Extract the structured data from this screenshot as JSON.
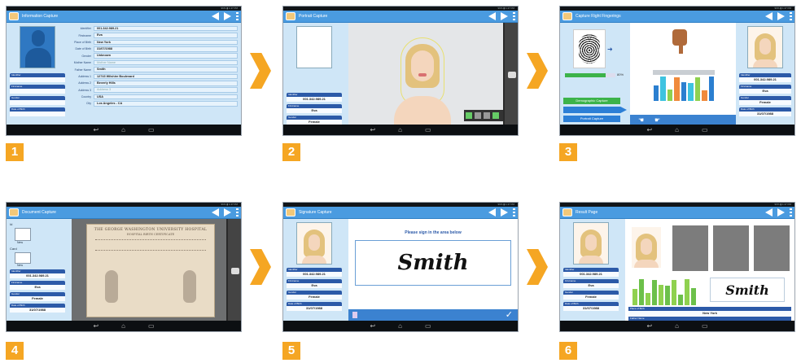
{
  "steps": [
    {
      "badge": "1",
      "title": "Information Capture"
    },
    {
      "badge": "2",
      "title": "Portrait Capture"
    },
    {
      "badge": "3",
      "title": "Capture Right Fingerings"
    },
    {
      "badge": "4",
      "title": "Document Capture"
    },
    {
      "badge": "5",
      "title": "Signature Capture"
    },
    {
      "badge": "6",
      "title": "Result Page"
    }
  ],
  "status_bar": "96% ▮ 1:47 PM",
  "form": {
    "rows": [
      {
        "label": "Identifier",
        "value": "001.342.989.21"
      },
      {
        "label": "Firstname",
        "value": "Eva"
      },
      {
        "label": "Place of Birth",
        "value": "New York"
      },
      {
        "label": "Date of Birth",
        "value": "31/07/1988"
      },
      {
        "label": "Gender",
        "value": "Unknown"
      },
      {
        "label": "Mother Name",
        "value": "Mother Name",
        "placeholder": true
      },
      {
        "label": "Father Name",
        "value": "Smith"
      },
      {
        "label": "Address 1",
        "value": "12743 Wilshire Boulevard"
      },
      {
        "label": "Address 2",
        "value": "Beverly Hills"
      },
      {
        "label": "Address 3",
        "value": "Address 3",
        "placeholder": true
      },
      {
        "label": "Country",
        "value": "USA"
      },
      {
        "label": "City",
        "value": "Los Angeles - CA"
      }
    ]
  },
  "person": {
    "labels": [
      "Identifier",
      "Firstname",
      "Gender",
      "Date of Birth"
    ],
    "values": [
      "001.342.989.21",
      "Eva",
      "Female",
      "31/07/1988"
    ]
  },
  "fingerprint": {
    "progress_text": "80%",
    "progress": 0.8,
    "button1": "Demographic Capture",
    "button2": "Portrait Capture"
  },
  "doc": {
    "id_label": "Id",
    "card_label": "Card",
    "new_label": "New",
    "document_title": "THE GEORGE WASHINGTON UNIVERSITY HOSPITAL",
    "cert_title": "HOSPITAL BIRTH CERTIFICATE"
  },
  "signature": {
    "prompt": "Please sign in the area below",
    "text": "Smith"
  },
  "result": {
    "signature": "Smith",
    "place_label": "Place of Birth",
    "place_value": "New York",
    "father_label": "Father Name"
  },
  "nav": {
    "back": "↩",
    "home": "⌂",
    "recent": "▭"
  },
  "colors": {
    "accent": "#f5a623",
    "action_bar": "#4a9be0",
    "label": "#2c5aa8"
  }
}
